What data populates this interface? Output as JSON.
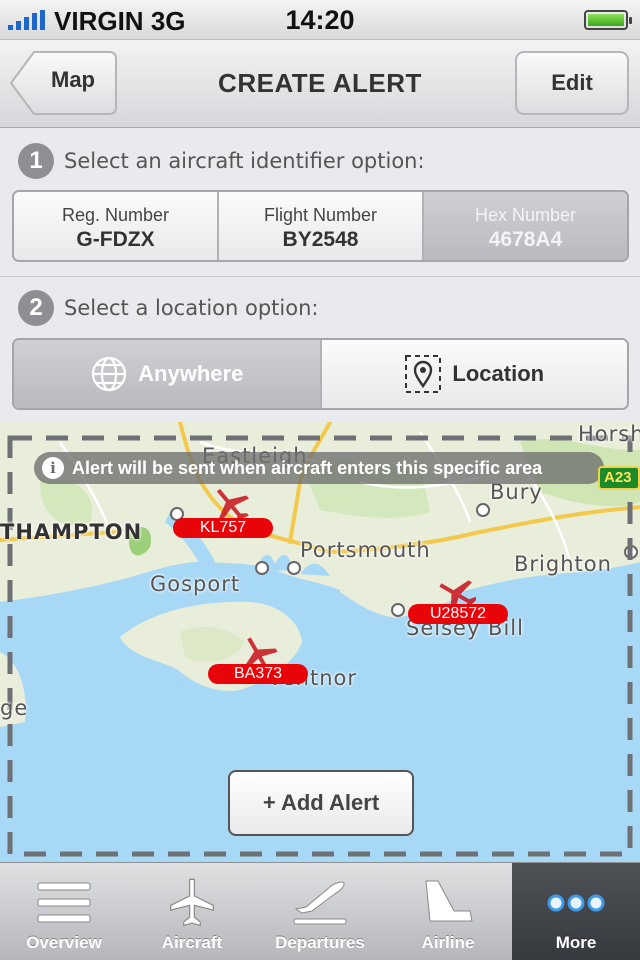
{
  "status_bar": {
    "carrier": "VIRGIN",
    "network": "3G",
    "time": "14:20"
  },
  "nav": {
    "back_label": "Map",
    "title": "CREATE ALERT",
    "edit_label": "Edit"
  },
  "step1": {
    "number": "1",
    "text": "Select an aircraft identifier option:",
    "options": [
      {
        "label": "Reg. Number",
        "value": "G-FDZX"
      },
      {
        "label": "Flight Number",
        "value": "BY2548"
      },
      {
        "label": "Hex Number",
        "value": "4678A4",
        "selected": true
      }
    ]
  },
  "step2": {
    "number": "2",
    "text": "Select a location option:",
    "options": [
      {
        "label": "Anywhere",
        "icon": "globe-icon",
        "selected": true
      },
      {
        "label": "Location",
        "icon": "location-pin-icon"
      }
    ]
  },
  "map": {
    "notice": "Alert will be sent when aircraft enters this specific area",
    "road_badge": "A23",
    "places": [
      "Eastleigh",
      "THAMPTON",
      "Horsh",
      "Bury",
      "Portsmouth",
      "Gosport",
      "Brighton",
      "Selsey Bill",
      "Ventnor",
      "ge"
    ],
    "flights": [
      "KL757",
      "U28572",
      "BA373"
    ],
    "add_alert_label": "+ Add Alert"
  },
  "tab_bar": [
    {
      "label": "Overview",
      "icon": "list-icon"
    },
    {
      "label": "Aircraft",
      "icon": "airplane-icon"
    },
    {
      "label": "Departures",
      "icon": "departures-icon"
    },
    {
      "label": "Airline",
      "icon": "tail-fin-icon"
    },
    {
      "label": "More",
      "icon": "more-dots-icon",
      "active": true
    }
  ],
  "colors": {
    "accent_flight_tag": "#e8050a",
    "signal": "#1e66c8",
    "battery": "#3aa81c",
    "sea": "#a7d8f5",
    "land": "#e9eedb"
  }
}
